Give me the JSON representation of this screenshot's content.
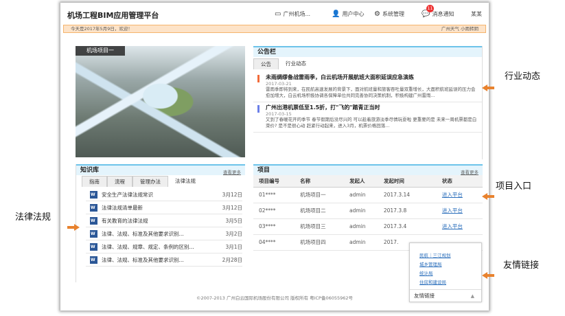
{
  "header": {
    "title": "机场工程BIM应用管理平台",
    "nav": [
      {
        "label": "广州机场...",
        "icon": "monitor-icon"
      },
      {
        "label": "用户中心",
        "icon": "user-icon"
      },
      {
        "label": "系统管理",
        "icon": "gear-icon"
      },
      {
        "label": "消息通知",
        "icon": "chat-icon",
        "badge": "11"
      },
      {
        "label": "某某"
      }
    ]
  },
  "notice": {
    "welcome": "今天是2017年5月9日，欢迎！",
    "weather": "广州天气  小雨转阴"
  },
  "banner": {
    "label": "机场项目一"
  },
  "bulletin": {
    "title": "公告栏",
    "tabs": [
      "公告",
      "行业动态"
    ],
    "items": [
      {
        "title": "未雨绸缪备战雷雨季，白云机场开展航班大面积延误应急演练",
        "date": "2017-03-21",
        "text": "雷雨季即将到来，在民航高速发展的背景下，面对航班量和旅客吞吐量双重增长，大面积航班延误的压力会愈加增大，白云机场积极协调各保障单位共同完善协同决策机制，积极构建广州雷雨...",
        "color": "#f26b3a"
      },
      {
        "title": "广州出港机票低至1.5折，打\"飞的\"踏青正当时",
        "date": "2017-03-15",
        "text": "又到了春暖花开的季节 春节假期后没尽兴的 可以趁着旅游淡季尽情玩耍啦 更重要的是 未来一周机票都是白菜价? 是不是很心动 赶紧行动起来，进入3月，机票价格回落...",
        "color": "#6b7fe8"
      }
    ]
  },
  "knowledge": {
    "title": "知识库",
    "more": "查看更多",
    "tabs": [
      "指南",
      "流程",
      "管理办法",
      "法律法规"
    ],
    "docs": [
      {
        "name": "安全生产法律法规常识",
        "date": "3月12日"
      },
      {
        "name": "法律法规清单最新",
        "date": "3月12日"
      },
      {
        "name": "有关教育的法律法规",
        "date": "3月5日"
      },
      {
        "name": "法律、法规、标准及其他要求识别...",
        "date": "3月2日"
      },
      {
        "name": "法律、法规、规章、规定、条例的区别...",
        "date": "3月1日"
      },
      {
        "name": "法律、法规、标准及其他要求识别...",
        "date": "2月28日"
      }
    ]
  },
  "projects": {
    "title": "项目",
    "more": "查看更多",
    "columns": [
      "项目编号",
      "名称",
      "发起人",
      "发起时间",
      "状态"
    ],
    "rows": [
      [
        "01****",
        "机场项目一",
        "admin",
        "2017.3.14",
        "进入平台"
      ],
      [
        "02****",
        "机场项目二",
        "admin",
        "2017.3.8",
        "进入平台"
      ],
      [
        "03****",
        "机场项目三",
        "admin",
        "2017.3.4",
        "进入平台"
      ],
      [
        "04****",
        "机场项目四",
        "admin",
        "2017.",
        ""
      ]
    ]
  },
  "links": {
    "title": "友情链接",
    "items": [
      "民航｜三江规划",
      "城乡管理局",
      "统计局",
      "住房和建设局"
    ]
  },
  "footer": "©2007-2013 广州白云国际机场股份有限公司 版权所有 粤ICP备06055962号",
  "annotations": {
    "industry": "行业动态",
    "project": "项目入口",
    "law": "法律法规",
    "links": "友情链接"
  },
  "colors": {
    "accent": "#6cc3ea",
    "arrow": "#e8822e"
  }
}
